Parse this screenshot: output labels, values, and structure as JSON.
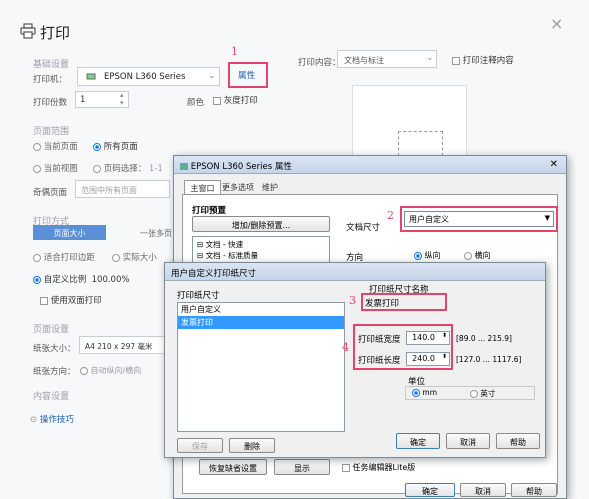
{
  "print": {
    "title": "打印",
    "section_basic": "基础设置",
    "printer_label": "打印机：",
    "printer_value": "EPSON L360 Series",
    "properties_button": "属性",
    "copies_label": "打印份数",
    "copies_value": "1",
    "color_label": "颜色",
    "grayscale_label": "灰度打印",
    "content_label": "打印内容：",
    "content_value": "文档与标注",
    "print_annotation_label": "打印注释内容",
    "range_section": "页面范围",
    "all_pages": "所有页面",
    "current_page": "当前页面",
    "current_view": "当前视图",
    "page_select": "页码选择：",
    "page_select_value": "1-1",
    "odd_even_label": "奇偶页面",
    "odd_even_value": "范围中所有页面",
    "mode_section": "打印方式",
    "page_size_tab": "页面大小",
    "multi_page_tab": "一张多页",
    "fit_margin": "适合打印边距",
    "actual_size": "实际大小",
    "custom_scale": "自定义比例",
    "custom_scale_value": "100.00%",
    "duplex": "使用双面打印",
    "page_setup": "页面设置",
    "paper_size_label": "纸张大小：",
    "paper_size_value": "A4 210 x 297 毫米",
    "orientation_label": "纸张方向：",
    "orientation_value": "自动纵向/横向",
    "content_setup": "内容设置",
    "tips_link": "操作技巧",
    "close_icon": "×"
  },
  "annotations": {
    "n1": "1",
    "n2": "2",
    "n3": "3",
    "n4": "4"
  },
  "props": {
    "title": "EPSON L360 Series 属性",
    "tabs": [
      "主窗口",
      "更多选项",
      "维护"
    ],
    "presets_label": "打印预置",
    "add_preset_button": "增加/删除预置...",
    "preset_items": [
      "文档 - 快速",
      "文档 - 标准质量"
    ],
    "doc_size_label": "文档尺寸",
    "doc_size_value": "用户自定义",
    "direction_label": "方向",
    "portrait": "纵向",
    "landscape": "横向",
    "restore_button": "恢复缺省设置",
    "display_button": "显示",
    "task_label": "任务编辑器Lite版",
    "ok": "确定",
    "cancel": "取消",
    "help": "帮助"
  },
  "custom": {
    "title": "用户自定义打印纸尺寸",
    "list_label": "打印纸尺寸",
    "list_items": [
      "用户自定义",
      "发票打印"
    ],
    "name_label": "打印纸尺寸名称",
    "name_value": "发票打印",
    "width_label": "打印纸宽度",
    "width_value": "140.0",
    "width_range": "[89.0 ... 215.9]",
    "height_label": "打印纸长度",
    "height_value": "240.0",
    "height_range": "[127.0 ... 1117.6]",
    "unit_label": "单位",
    "unit_mm": "mm",
    "unit_inch": "英寸",
    "save": "保存",
    "delete": "删除",
    "ok": "确定",
    "cancel": "取消",
    "help": "帮助"
  }
}
